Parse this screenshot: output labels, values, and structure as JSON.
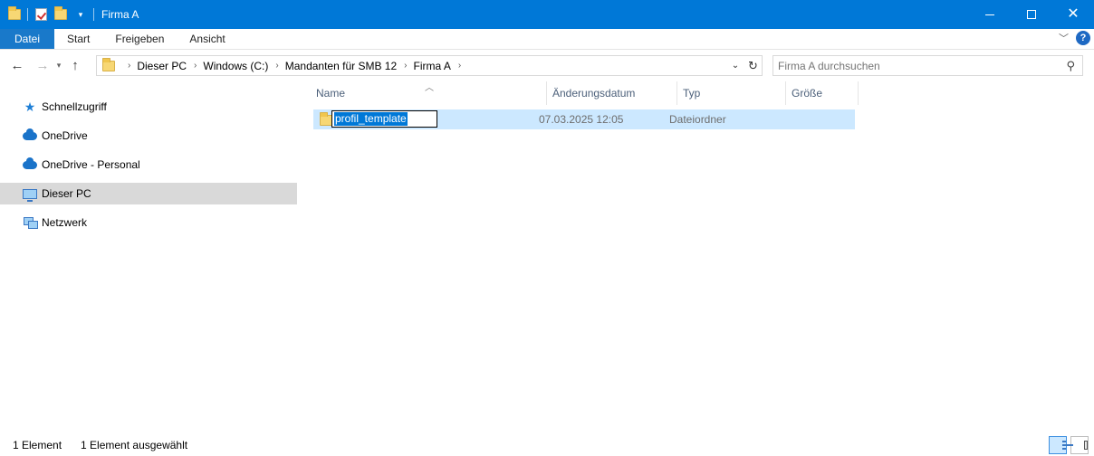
{
  "window": {
    "title": "Firma A"
  },
  "ribbon": {
    "tabs": [
      "Datei",
      "Start",
      "Freigeben",
      "Ansicht"
    ],
    "help_label": "?"
  },
  "address": {
    "crumbs": [
      "Dieser PC",
      "Windows (C:)",
      "Mandanten für SMB 12",
      "Firma A"
    ]
  },
  "search": {
    "placeholder": "Firma A durchsuchen"
  },
  "sidebar": {
    "items": [
      {
        "label": "Schnellzugriff",
        "icon": "star-icon"
      },
      {
        "label": "OneDrive",
        "icon": "cloud-icon"
      },
      {
        "label": "OneDrive - Personal",
        "icon": "cloud-icon"
      },
      {
        "label": "Dieser PC",
        "icon": "computer-icon",
        "selected": true
      },
      {
        "label": "Netzwerk",
        "icon": "network-icon"
      }
    ]
  },
  "columns": {
    "name": "Name",
    "date": "Änderungsdatum",
    "type": "Typ",
    "size": "Größe"
  },
  "files": [
    {
      "name": "profil_template",
      "date": "07.03.2025 12:05",
      "type": "Dateiordner",
      "size": "",
      "renaming": true
    }
  ],
  "status": {
    "count": "1 Element",
    "selected": "1 Element ausgewählt"
  },
  "colors": {
    "titlebar": "#0078d7",
    "file_tab": "#1979ca",
    "selection": "#cce8ff",
    "sidebar_selected": "#d9d9d9"
  }
}
